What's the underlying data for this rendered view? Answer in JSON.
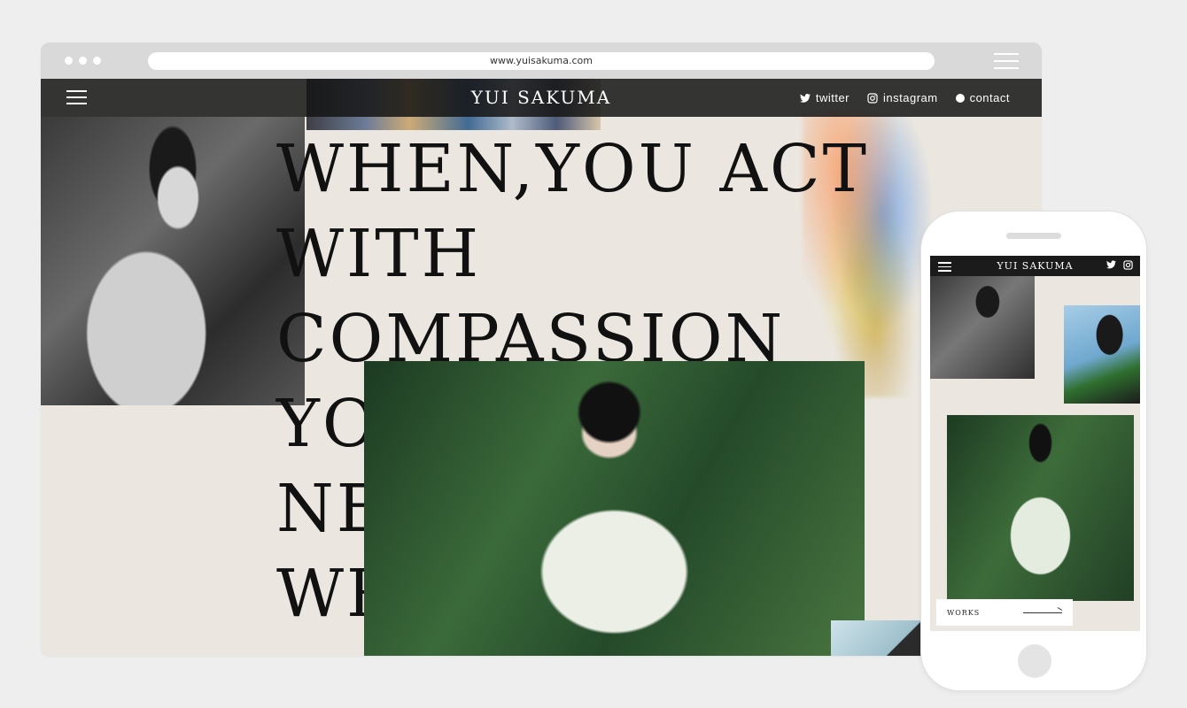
{
  "browser": {
    "url": "www.yuisakuma.com"
  },
  "site": {
    "brand": "YUI SAKUMA",
    "nav": {
      "twitter": "twitter",
      "instagram": "instagram",
      "contact": "contact"
    },
    "headline": "WHEN,YOU ACT WITH\nCOMPASSION YOU WILL\nNEVER BE WRONG."
  },
  "mobile": {
    "brand": "YUI SAKUMA",
    "works_label": "WORKS"
  },
  "icons": {
    "menu": "hamburger-icon",
    "twitter": "twitter-icon",
    "instagram": "instagram-icon",
    "contact": "circle-icon",
    "arrow": "arrow-right-icon"
  }
}
